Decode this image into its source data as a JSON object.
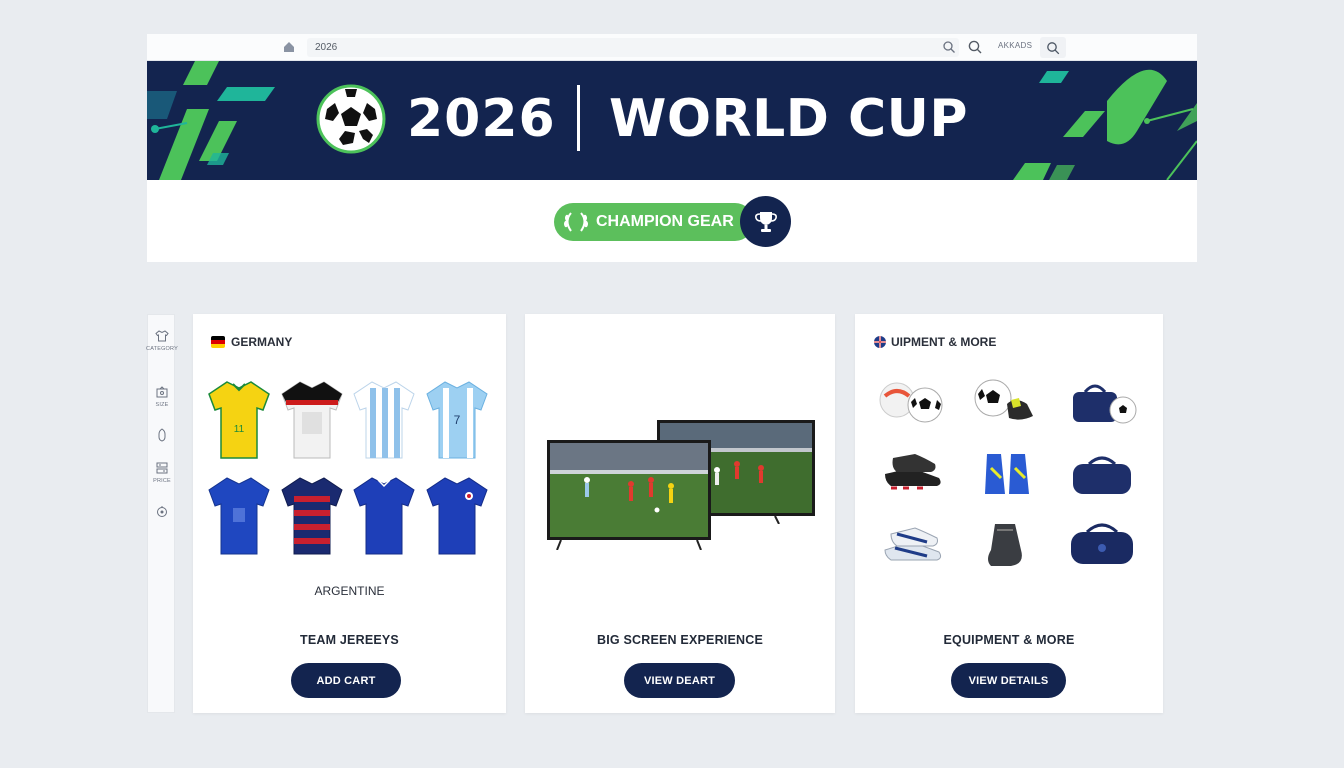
{
  "topbar": {
    "address": "2026",
    "account_label": "AKKADS"
  },
  "banner": {
    "year": "2026",
    "title": "WORLD CUP"
  },
  "champion": {
    "label": "CHAMPION GEAR"
  },
  "sidebar": {
    "items": [
      {
        "icon": "shirt-icon",
        "label": "CATEGORY"
      },
      {
        "icon": "size-icon",
        "label": "SIZE"
      },
      {
        "icon": "shield-icon",
        "label": ""
      },
      {
        "icon": "price-icon",
        "label": "PRICE"
      },
      {
        "icon": "settings-icon",
        "label": ""
      }
    ]
  },
  "cards": [
    {
      "header": "GERMANY",
      "subtitle": "ARGENTINE",
      "title": "TEAM JEREEYS",
      "button": "ADD CART"
    },
    {
      "header": "",
      "subtitle": "",
      "title": "BIG SCREEN EXPERIENCE",
      "button": "VIEW DEART"
    },
    {
      "header": "UIPMENT & MORE",
      "subtitle": "",
      "title": "EQUIPMENT & MORE",
      "button": "VIEW DETAILS"
    }
  ],
  "colors": {
    "navy": "#13244f",
    "green": "#5cbf5c",
    "accent_green": "#4cc25a",
    "teal": "#1fb59a",
    "background": "#e9ecf0"
  }
}
